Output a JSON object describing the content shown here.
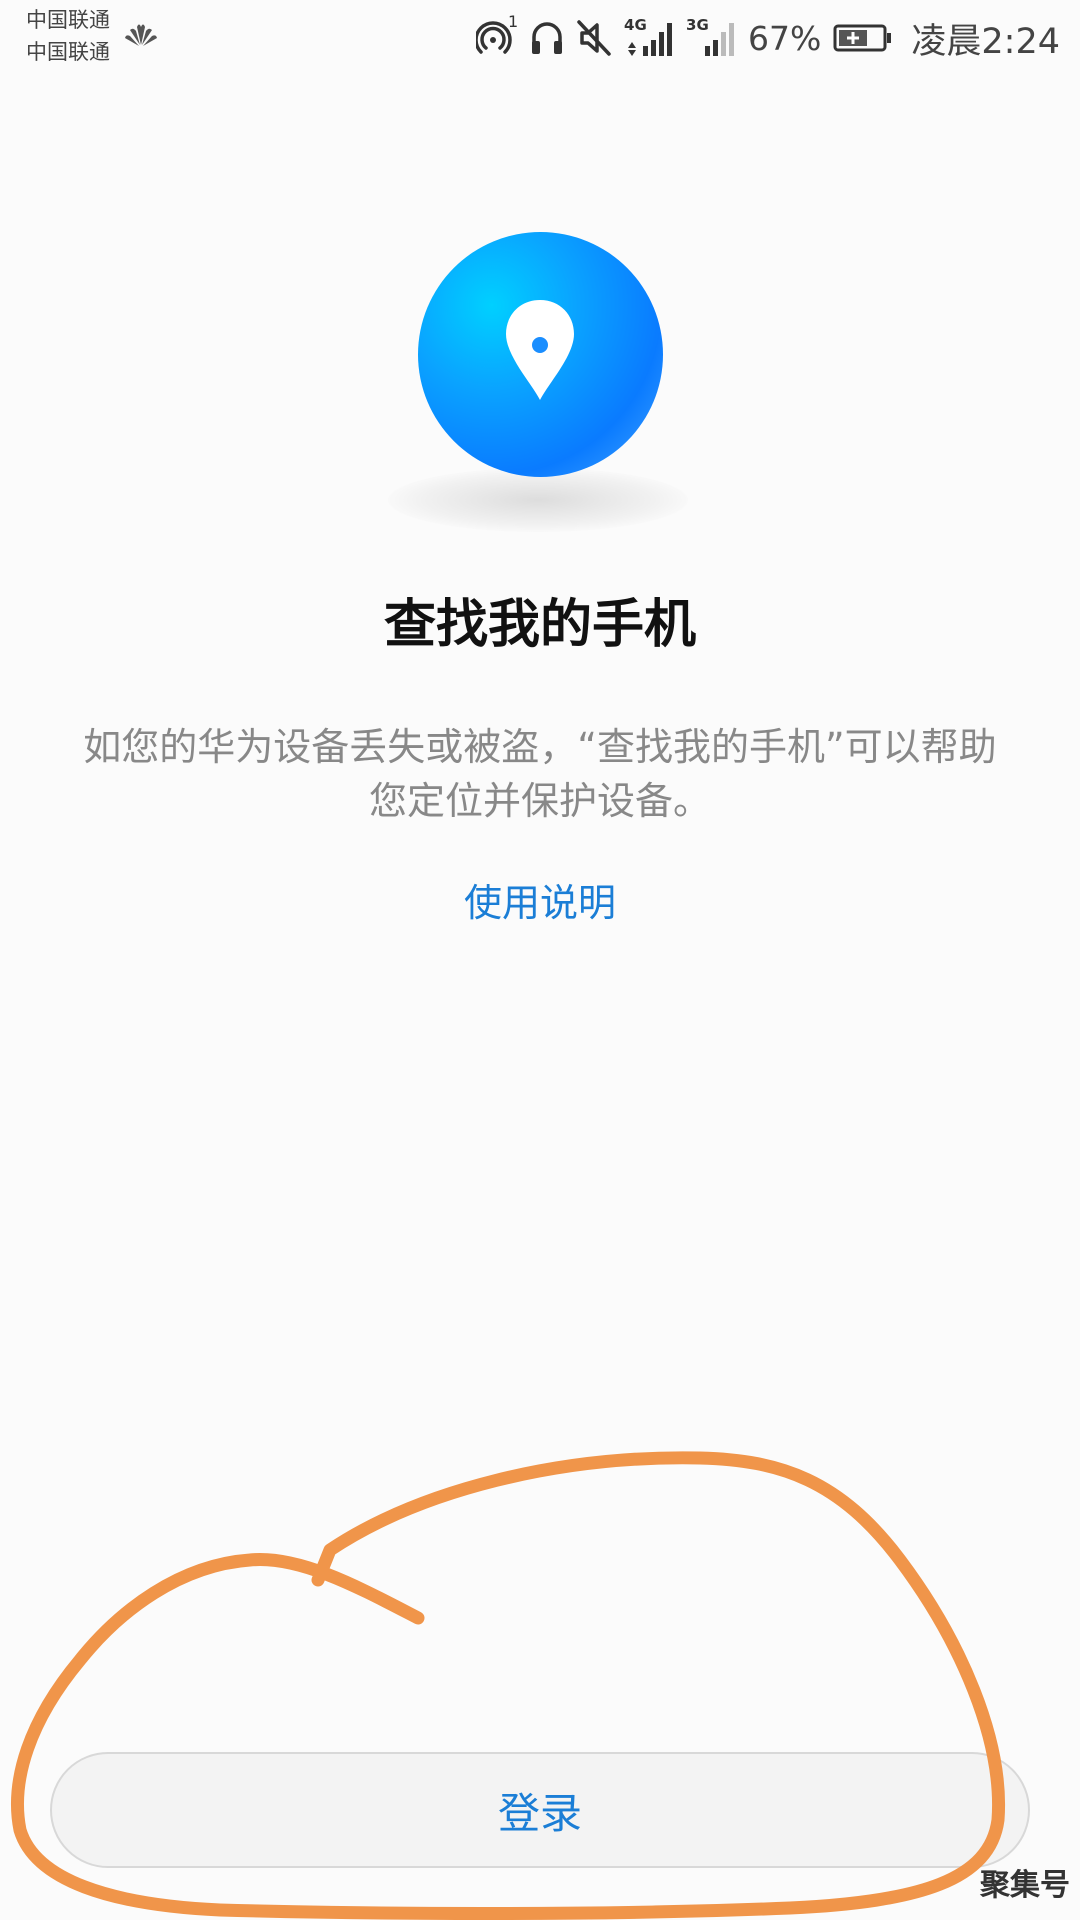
{
  "status_bar": {
    "carrier_1": "中国联通",
    "carrier_2": "中国联通",
    "hotspot_count": "1",
    "network_4g": "4G",
    "network_3g": "3G",
    "battery_percent": "67%",
    "time": "凌晨2:24"
  },
  "main": {
    "title": "查找我的手机",
    "description": "如您的华为设备丢失或被盗，“查找我的手机”可以帮助您定位并保护设备。",
    "help_link": "使用说明",
    "login_label": "登录"
  },
  "watermark": "聚集号",
  "colors": {
    "accent": "#1b7ed6",
    "circle_blue": "#0a8bff",
    "annotation_orange": "#f0954a"
  },
  "icons": [
    "huawei-logo-icon",
    "hotspot-icon",
    "headphones-icon",
    "mute-icon",
    "signal-icon",
    "battery-icon",
    "location-pin-icon"
  ]
}
